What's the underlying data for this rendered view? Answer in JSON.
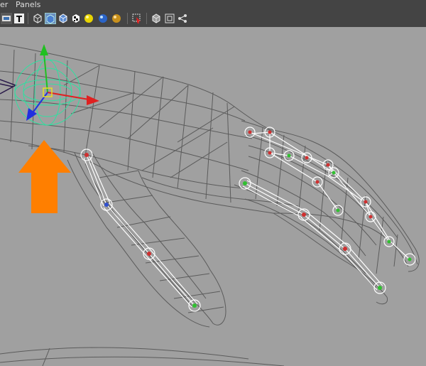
{
  "menubar": {
    "items": [
      {
        "label": "er"
      },
      {
        "label": "Panels"
      }
    ]
  },
  "toolbar": {
    "tools": [
      {
        "icon": "rotate-view-icon"
      },
      {
        "icon": "text-tool-icon"
      },
      {
        "icon": "wireframe-cube-icon"
      },
      {
        "icon": "smooth-shade-cube-icon"
      },
      {
        "icon": "shaded-wireframe-cube-icon"
      },
      {
        "icon": "textured-checker-icon"
      },
      {
        "icon": "default-light-sphere-icon"
      },
      {
        "icon": "all-lights-sphere-icon"
      },
      {
        "icon": "shadows-sphere-icon"
      },
      {
        "icon": "isolate-select-icon"
      },
      {
        "icon": "xray-cube-icon"
      },
      {
        "icon": "xray-joints-icon"
      },
      {
        "icon": "share-node-icon"
      }
    ]
  },
  "viewport": {
    "annotation": {
      "icon": "orange-up-arrow",
      "color": "#ff7f00"
    },
    "colors": {
      "background": "#a0a0a0",
      "wire": "#5b5b5b",
      "bone": "#ffffff",
      "manipulator": "#30e0a0",
      "axis_x": "#e02020",
      "axis_y": "#20c020",
      "axis_z": "#2030e0"
    }
  }
}
